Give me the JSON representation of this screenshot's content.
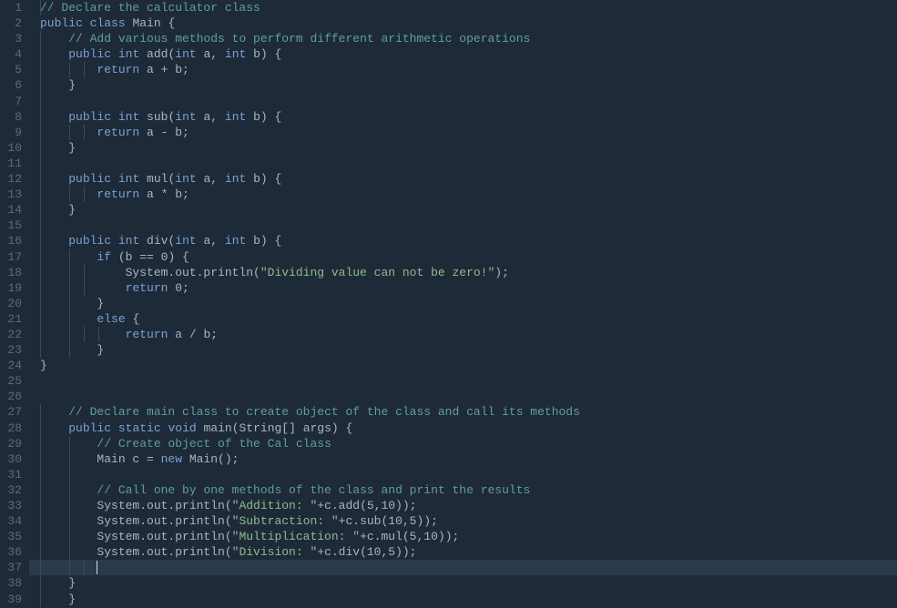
{
  "lines": [
    {
      "n": 1,
      "guides": [
        0
      ],
      "tokens": [
        {
          "c": "cmt",
          "t": "// Declare the calculator class"
        }
      ]
    },
    {
      "n": 2,
      "guides": [],
      "tokens": [
        {
          "c": "kw",
          "t": "public"
        },
        {
          "c": "punct",
          "t": " "
        },
        {
          "c": "kw",
          "t": "class"
        },
        {
          "c": "punct",
          "t": " Main {"
        }
      ]
    },
    {
      "n": 3,
      "guides": [
        0
      ],
      "tokens": [
        {
          "c": "punct",
          "t": "    "
        },
        {
          "c": "cmt",
          "t": "// Add various methods to perform different arithmetic operations"
        }
      ]
    },
    {
      "n": 4,
      "guides": [
        0
      ],
      "tokens": [
        {
          "c": "punct",
          "t": "    "
        },
        {
          "c": "kw",
          "t": "public"
        },
        {
          "c": "punct",
          "t": " "
        },
        {
          "c": "type",
          "t": "int"
        },
        {
          "c": "punct",
          "t": " add("
        },
        {
          "c": "type",
          "t": "int"
        },
        {
          "c": "punct",
          "t": " a, "
        },
        {
          "c": "type",
          "t": "int"
        },
        {
          "c": "punct",
          "t": " b) {"
        }
      ]
    },
    {
      "n": 5,
      "guides": [
        0,
        1,
        2
      ],
      "tokens": [
        {
          "c": "punct",
          "t": "        "
        },
        {
          "c": "kw",
          "t": "return"
        },
        {
          "c": "punct",
          "t": " a + b;"
        }
      ]
    },
    {
      "n": 6,
      "guides": [
        0
      ],
      "tokens": [
        {
          "c": "punct",
          "t": "    }"
        }
      ]
    },
    {
      "n": 7,
      "guides": [
        0
      ],
      "tokens": [
        {
          "c": "punct",
          "t": ""
        }
      ]
    },
    {
      "n": 8,
      "guides": [
        0
      ],
      "tokens": [
        {
          "c": "punct",
          "t": "    "
        },
        {
          "c": "kw",
          "t": "public"
        },
        {
          "c": "punct",
          "t": " "
        },
        {
          "c": "type",
          "t": "int"
        },
        {
          "c": "punct",
          "t": " sub("
        },
        {
          "c": "type",
          "t": "int"
        },
        {
          "c": "punct",
          "t": " a, "
        },
        {
          "c": "type",
          "t": "int"
        },
        {
          "c": "punct",
          "t": " b) {"
        }
      ]
    },
    {
      "n": 9,
      "guides": [
        0,
        1,
        2
      ],
      "tokens": [
        {
          "c": "punct",
          "t": "        "
        },
        {
          "c": "kw",
          "t": "return"
        },
        {
          "c": "punct",
          "t": " a - b;"
        }
      ]
    },
    {
      "n": 10,
      "guides": [
        0
      ],
      "tokens": [
        {
          "c": "punct",
          "t": "    }"
        }
      ]
    },
    {
      "n": 11,
      "guides": [
        0
      ],
      "tokens": [
        {
          "c": "punct",
          "t": ""
        }
      ]
    },
    {
      "n": 12,
      "guides": [
        0
      ],
      "tokens": [
        {
          "c": "punct",
          "t": "    "
        },
        {
          "c": "kw",
          "t": "public"
        },
        {
          "c": "punct",
          "t": " "
        },
        {
          "c": "type",
          "t": "int"
        },
        {
          "c": "punct",
          "t": " mul("
        },
        {
          "c": "type",
          "t": "int"
        },
        {
          "c": "punct",
          "t": " a, "
        },
        {
          "c": "type",
          "t": "int"
        },
        {
          "c": "punct",
          "t": " b) {"
        }
      ]
    },
    {
      "n": 13,
      "guides": [
        0,
        1,
        2
      ],
      "tokens": [
        {
          "c": "punct",
          "t": "        "
        },
        {
          "c": "kw",
          "t": "return"
        },
        {
          "c": "punct",
          "t": " a * b;"
        }
      ]
    },
    {
      "n": 14,
      "guides": [
        0
      ],
      "tokens": [
        {
          "c": "punct",
          "t": "    }"
        }
      ]
    },
    {
      "n": 15,
      "guides": [
        0
      ],
      "tokens": [
        {
          "c": "punct",
          "t": ""
        }
      ]
    },
    {
      "n": 16,
      "guides": [
        0
      ],
      "tokens": [
        {
          "c": "punct",
          "t": "    "
        },
        {
          "c": "kw",
          "t": "public"
        },
        {
          "c": "punct",
          "t": " "
        },
        {
          "c": "type",
          "t": "int"
        },
        {
          "c": "punct",
          "t": " div("
        },
        {
          "c": "type",
          "t": "int"
        },
        {
          "c": "punct",
          "t": " a, "
        },
        {
          "c": "type",
          "t": "int"
        },
        {
          "c": "punct",
          "t": " b) {"
        }
      ]
    },
    {
      "n": 17,
      "guides": [
        0,
        1
      ],
      "tokens": [
        {
          "c": "punct",
          "t": "        "
        },
        {
          "c": "kw",
          "t": "if"
        },
        {
          "c": "punct",
          "t": " (b == 0) {"
        }
      ]
    },
    {
      "n": 18,
      "guides": [
        0,
        1,
        2
      ],
      "tokens": [
        {
          "c": "punct",
          "t": "            System.out.println("
        },
        {
          "c": "str",
          "t": "\"Dividing value can not be zero!\""
        },
        {
          "c": "punct",
          "t": ");"
        }
      ]
    },
    {
      "n": 19,
      "guides": [
        0,
        1,
        2
      ],
      "tokens": [
        {
          "c": "punct",
          "t": "            "
        },
        {
          "c": "kw",
          "t": "return"
        },
        {
          "c": "punct",
          "t": " 0;"
        }
      ]
    },
    {
      "n": 20,
      "guides": [
        0,
        1
      ],
      "tokens": [
        {
          "c": "punct",
          "t": "        }"
        }
      ]
    },
    {
      "n": 21,
      "guides": [
        0,
        1
      ],
      "tokens": [
        {
          "c": "punct",
          "t": "        "
        },
        {
          "c": "kw",
          "t": "else"
        },
        {
          "c": "punct",
          "t": " {"
        }
      ]
    },
    {
      "n": 22,
      "guides": [
        0,
        1,
        2,
        3
      ],
      "tokens": [
        {
          "c": "punct",
          "t": "            "
        },
        {
          "c": "kw",
          "t": "return"
        },
        {
          "c": "punct",
          "t": " a / b;"
        }
      ]
    },
    {
      "n": 23,
      "guides": [
        0,
        1
      ],
      "tokens": [
        {
          "c": "punct",
          "t": "        }"
        }
      ]
    },
    {
      "n": 24,
      "guides": [],
      "tokens": [
        {
          "c": "punct",
          "t": "}"
        }
      ]
    },
    {
      "n": 25,
      "guides": [],
      "tokens": [
        {
          "c": "punct",
          "t": ""
        }
      ]
    },
    {
      "n": 26,
      "guides": [],
      "tokens": [
        {
          "c": "punct",
          "t": ""
        }
      ]
    },
    {
      "n": 27,
      "guides": [
        0
      ],
      "tokens": [
        {
          "c": "punct",
          "t": "    "
        },
        {
          "c": "cmt",
          "t": "// Declare main class to create object of the class and call its methods"
        }
      ]
    },
    {
      "n": 28,
      "guides": [
        0
      ],
      "tokens": [
        {
          "c": "punct",
          "t": "    "
        },
        {
          "c": "kw",
          "t": "public"
        },
        {
          "c": "punct",
          "t": " "
        },
        {
          "c": "kw",
          "t": "static"
        },
        {
          "c": "punct",
          "t": " "
        },
        {
          "c": "type",
          "t": "void"
        },
        {
          "c": "punct",
          "t": " main(String[] args) {"
        }
      ]
    },
    {
      "n": 29,
      "guides": [
        0,
        1
      ],
      "tokens": [
        {
          "c": "punct",
          "t": "        "
        },
        {
          "c": "cmt",
          "t": "// Create object of the Cal class"
        }
      ]
    },
    {
      "n": 30,
      "guides": [
        0,
        1
      ],
      "tokens": [
        {
          "c": "punct",
          "t": "        Main c = "
        },
        {
          "c": "kw",
          "t": "new"
        },
        {
          "c": "punct",
          "t": " Main();"
        }
      ]
    },
    {
      "n": 31,
      "guides": [
        0,
        1
      ],
      "tokens": [
        {
          "c": "punct",
          "t": ""
        }
      ]
    },
    {
      "n": 32,
      "guides": [
        0,
        1
      ],
      "tokens": [
        {
          "c": "punct",
          "t": "        "
        },
        {
          "c": "cmt",
          "t": "// Call one by one methods of the class and print the results"
        }
      ]
    },
    {
      "n": 33,
      "guides": [
        0,
        1
      ],
      "tokens": [
        {
          "c": "punct",
          "t": "        System.out.println("
        },
        {
          "c": "str",
          "t": "\"Addition: \""
        },
        {
          "c": "punct",
          "t": "+c.add(5,10));"
        }
      ]
    },
    {
      "n": 34,
      "guides": [
        0,
        1
      ],
      "tokens": [
        {
          "c": "punct",
          "t": "        System.out.println("
        },
        {
          "c": "str",
          "t": "\"Subtraction: \""
        },
        {
          "c": "punct",
          "t": "+c.sub(10,5));"
        }
      ]
    },
    {
      "n": 35,
      "guides": [
        0,
        1
      ],
      "tokens": [
        {
          "c": "punct",
          "t": "        System.out.println("
        },
        {
          "c": "str",
          "t": "\"Multiplication: \""
        },
        {
          "c": "punct",
          "t": "+c.mul(5,10));"
        }
      ]
    },
    {
      "n": 36,
      "guides": [
        0,
        1
      ],
      "tokens": [
        {
          "c": "punct",
          "t": "        System.out.println("
        },
        {
          "c": "str",
          "t": "\"Division: \""
        },
        {
          "c": "punct",
          "t": "+c.div(10,5));"
        }
      ]
    },
    {
      "n": 37,
      "guides": [
        0,
        1,
        2
      ],
      "tokens": [
        {
          "c": "punct",
          "t": "        "
        }
      ],
      "current": true,
      "cursor": true
    },
    {
      "n": 38,
      "guides": [
        0
      ],
      "tokens": [
        {
          "c": "punct",
          "t": "    }"
        }
      ]
    },
    {
      "n": 39,
      "guides": [
        0
      ],
      "tokens": [
        {
          "c": "punct",
          "t": "    }"
        }
      ]
    }
  ],
  "guideOffsets": [
    44,
    76,
    92,
    108
  ]
}
